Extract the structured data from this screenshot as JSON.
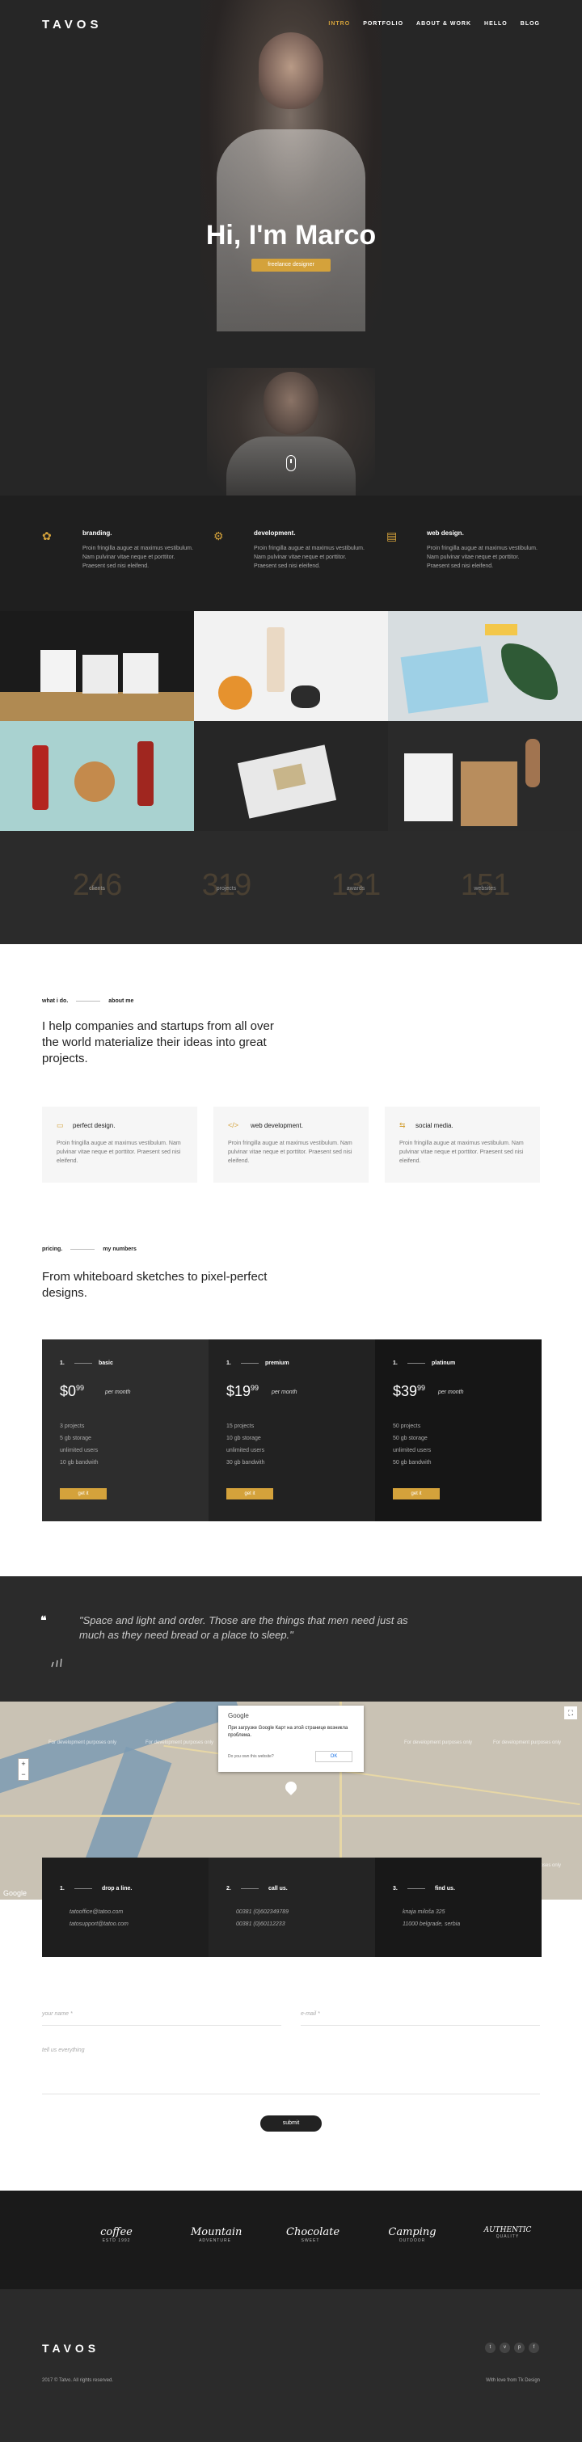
{
  "brand": {
    "logo": "TAVOS"
  },
  "nav": {
    "items": [
      "INTRO",
      "PORTFOLIO",
      "ABOUT & WORK",
      "HELLO",
      "BLOG"
    ],
    "active": "INTRO"
  },
  "hero": {
    "title": "Hi, I'm Marco",
    "tag": "freelance designer"
  },
  "services": [
    {
      "icon": "branding-icon",
      "title": "branding.",
      "desc": "Proin fringilla augue at maximus vestibulum. Nam pulvinar vitae neque et porttitor. Praesent sed nisi eleifend."
    },
    {
      "icon": "development-icon",
      "title": "development.",
      "desc": "Proin fringilla augue at maximus vestibulum. Nam pulvinar vitae neque et porttitor. Praesent sed nisi eleifend."
    },
    {
      "icon": "web-design-icon",
      "title": "web design.",
      "desc": "Proin fringilla augue at maximus vestibulum. Nam pulvinar vitae neque et porttitor. Praesent sed nisi eleifend."
    }
  ],
  "counters": [
    {
      "num": "246",
      "label": "clients"
    },
    {
      "num": "319",
      "label": "projects"
    },
    {
      "num": "131",
      "label": "awards"
    },
    {
      "num": "151",
      "label": "websites"
    }
  ],
  "about": {
    "tab1": "what i do.",
    "tab2": "about me",
    "heading": "I help companies and startups from all over the world materialize their ideas into great projects.",
    "cards": [
      {
        "icon": "▭",
        "title": "perfect design.",
        "desc": "Proin fringilla augue at maximus vestibulum. Nam pulvinar vitae neque et porttitor. Praesent sed nisi eleifend."
      },
      {
        "icon": "</>",
        "title": "web development.",
        "desc": "Proin fringilla augue at maximus vestibulum. Nam pulvinar vitae neque et porttitor. Praesent sed nisi eleifend."
      },
      {
        "icon": "⇆",
        "title": "social media.",
        "desc": "Proin fringilla augue at maximus vestibulum. Nam pulvinar vitae neque et porttitor. Praesent sed nisi eleifend."
      }
    ]
  },
  "pricing": {
    "tab1": "pricing.",
    "tab2": "my numbers",
    "heading": "From whiteboard sketches to pixel-perfect designs.",
    "plans": [
      {
        "num": "1.",
        "name": "basic",
        "price": "$0",
        "cents": "99",
        "per": "per month",
        "features": [
          "3 projects",
          "5 gb storage",
          "unlimited users",
          "10 gb bandwith"
        ],
        "button": "get it"
      },
      {
        "num": "1.",
        "name": "premium",
        "price": "$19",
        "cents": "99",
        "per": "per month",
        "features": [
          "15 projects",
          "10 gb storage",
          "unlimited users",
          "30 gb bandwith"
        ],
        "button": "get it"
      },
      {
        "num": "1.",
        "name": "platinum",
        "price": "$39",
        "cents": "99",
        "per": "per month",
        "features": [
          "50 projects",
          "50 gb storage",
          "unlimited users",
          "50 gb bandwith"
        ],
        "button": "get it"
      }
    ]
  },
  "quote": {
    "mark": "❝",
    "text": "\"Space and light and order. Those are the things that men need just as much as they need bread or a place to sleep.\""
  },
  "map": {
    "dialog_title": "Google",
    "dialog_message": "При загрузке Google Карт на этой странице возникла проблема.",
    "dialog_question": "Do you own this website?",
    "dialog_ok": "OK",
    "watermark": "For development purposes only",
    "google": "Google"
  },
  "contact": [
    {
      "num": "1.",
      "title": "drop a line.",
      "lines": [
        "tatooffice@tatoo.com",
        "tatosupport@tatoo.com"
      ]
    },
    {
      "num": "2.",
      "title": "call us.",
      "lines": [
        "00381 (0)602349789",
        "00381 (0)60112233"
      ]
    },
    {
      "num": "3.",
      "title": "find us.",
      "lines": [
        "knaja miloša 325",
        "11000 belgrade, serbia"
      ]
    }
  ],
  "form": {
    "name": "your name *",
    "email": "e-mail *",
    "message": "tell us everything",
    "submit": "submit"
  },
  "clients": [
    {
      "script": "coffee",
      "sub": "ESTD 1992"
    },
    {
      "script": "Mountain",
      "sub": "ADVENTURE"
    },
    {
      "script": "Chocolate",
      "sub": "SWEET"
    },
    {
      "script": "Camping",
      "sub": "OUTDOOR"
    },
    {
      "script": "AUTHENTIC",
      "sub": "QUALITY"
    }
  ],
  "footer": {
    "logo": "TAVOS",
    "copyright": "2017 © Tatvo. All rights reserved.",
    "made": "With love from Tk Design",
    "social": [
      "t",
      "v",
      "p",
      "f"
    ]
  },
  "colors": {
    "accent": "#d4a23b",
    "dark": "#262626"
  }
}
